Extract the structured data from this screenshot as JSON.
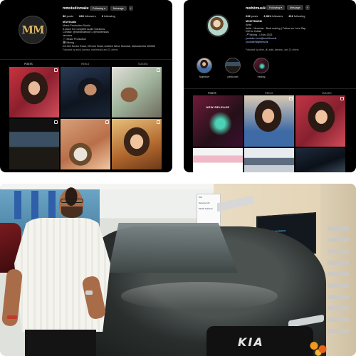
{
  "left_profile": {
    "username": "mmstudiomake",
    "stats": [
      {
        "value": "86",
        "label": "posts"
      },
      {
        "value": "626",
        "label": "followers"
      },
      {
        "value": "2",
        "label": "following"
      }
    ],
    "buttons": {
      "following": "Following ▾",
      "message": "Message",
      "add": "+"
    },
    "avatar_logo": "M",
    "bio_name": "M.M Studio",
    "bio_lines": [
      "Music Production Studio",
      "A place for Complete Audio Solutions",
      "Contact: @hardikrathod71 @mohitmusik",
      "services",
      "🎵 Music Production",
      "🎬 Mixing ...",
      "D2-104 Sector Road, Off Link Road, Andheri West, Mumbai, Maharashtra 400053"
    ],
    "follow_line": "Followed by ankit_karnwa, mohitmusik and 21 others",
    "tabs": [
      "POSTS",
      "REELS",
      "TAGGED"
    ],
    "tiles": [
      "t-woman",
      "t-man-cap",
      "t-guitar",
      "t-studio",
      "t-tabla",
      "t-smile"
    ]
  },
  "right_profile": {
    "username": "mohitmusik",
    "stats": [
      {
        "value": "232",
        "label": "posts"
      },
      {
        "value": "2,061",
        "label": "followers"
      },
      {
        "value": "211",
        "label": "following"
      }
    ],
    "buttons": {
      "following": "Following ▾",
      "message": "Message",
      "add": "+"
    },
    "bio_name": "MOHITMUSIK",
    "bio_lines": [
      "Artist",
      "Artist · Musician · Beat making | Follow me Love Rap",
      "DM for Collab",
      "🎤 Mixing - 1 Nov 2023",
      "youtube.com/@mohitmusik"
    ],
    "link": "youtube/Nightmuzik",
    "follow_line": "Followed by other_iff, ankit_karnwa_ and 21 others",
    "highlights": [
      {
        "label": "Nightdrive",
        "style": "t-woman2"
      },
      {
        "label": "pahila wali",
        "style": "t-studio"
      },
      {
        "label": "Healing",
        "style": "t-album"
      }
    ],
    "tabs": [
      "POSTS",
      "REELS",
      "TAGGED"
    ],
    "tile_text": "NEW RELEASE",
    "tiles": [
      "t-album",
      "t-woman2",
      "t-woman3",
      "t-poster",
      "t-office",
      "t-dark"
    ]
  },
  "photo": {
    "brand_badge": "KIA",
    "tv_text": "Kia · Experience",
    "info_board_lines": [
      "KIA",
      "Service info",
      "Model features"
    ]
  }
}
